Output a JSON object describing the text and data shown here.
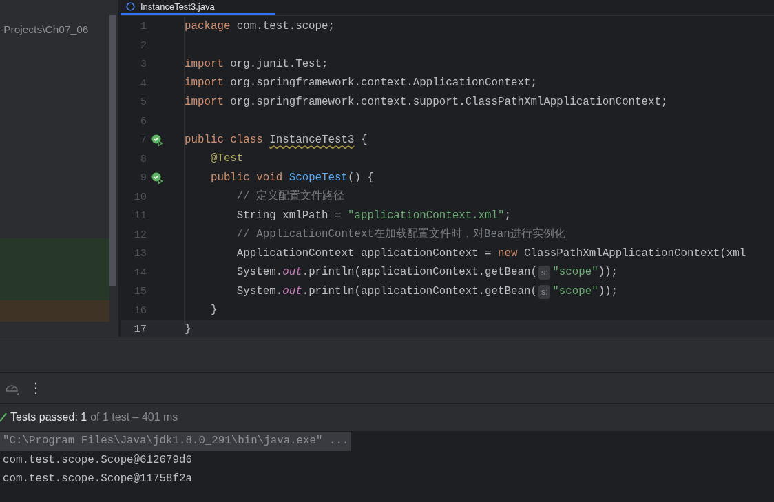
{
  "project_panel": {
    "path": "-Projects\\Ch07_06"
  },
  "editor_tabs": [
    {
      "label": "InstanceTest3.java",
      "selected": true
    }
  ],
  "code_lines": [
    {
      "number": "1",
      "run_icon": false,
      "current": false,
      "tokens": [
        {
          "kind": "keyword",
          "text": "package "
        },
        {
          "kind": "plain",
          "text": "com.test.scope;"
        }
      ]
    },
    {
      "number": "2",
      "run_icon": false,
      "current": false
    },
    {
      "number": "3",
      "run_icon": false,
      "current": false,
      "tokens": [
        {
          "kind": "keyword",
          "text": "import "
        },
        {
          "kind": "plain",
          "text": "org.junit.Test;"
        }
      ]
    },
    {
      "number": "4",
      "run_icon": false,
      "current": false,
      "tokens": [
        {
          "kind": "keyword",
          "text": "import "
        },
        {
          "kind": "plain",
          "text": "org.springframework.context.ApplicationContext;"
        }
      ]
    },
    {
      "number": "5",
      "run_icon": false,
      "current": false,
      "tokens": [
        {
          "kind": "keyword",
          "text": "import "
        },
        {
          "kind": "plain",
          "text": "org.springframework.context.support.ClassPathXmlApplicationContext;"
        }
      ]
    },
    {
      "number": "6",
      "run_icon": false,
      "current": false
    },
    {
      "number": "7",
      "run_icon": true,
      "current": false,
      "tokens": [
        {
          "kind": "keyword",
          "text": "public class "
        },
        {
          "kind": "warning",
          "text": "InstanceTest3"
        },
        {
          "kind": "plain",
          "text": " {"
        }
      ]
    },
    {
      "number": "8",
      "run_icon": false,
      "current": false,
      "tokens": [
        {
          "kind": "annotation",
          "text": "    @Test"
        }
      ]
    },
    {
      "number": "9",
      "run_icon": true,
      "current": false,
      "tokens": [
        {
          "kind": "keyword",
          "text": "    public void "
        },
        {
          "kind": "method",
          "text": "ScopeTest"
        },
        {
          "kind": "plain",
          "text": "() {"
        }
      ]
    },
    {
      "number": "10",
      "run_icon": false,
      "current": false,
      "tokens": [
        {
          "kind": "comment",
          "text": "        // 定义配置文件路径"
        }
      ]
    },
    {
      "number": "11",
      "run_icon": false,
      "current": false,
      "tokens": [
        {
          "kind": "plain",
          "text": "        String xmlPath = "
        },
        {
          "kind": "string",
          "text": "\"applicationContext.xml\""
        },
        {
          "kind": "plain",
          "text": ";"
        }
      ]
    },
    {
      "number": "12",
      "run_icon": false,
      "current": false,
      "tokens": [
        {
          "kind": "comment",
          "text": "        // ApplicationContext在加载配置文件时，对Bean进行实例化"
        }
      ]
    },
    {
      "number": "13",
      "run_icon": false,
      "current": false,
      "tokens": [
        {
          "kind": "plain",
          "text": "        ApplicationContext applicationContext = "
        },
        {
          "kind": "keyword",
          "text": "new "
        },
        {
          "kind": "plain",
          "text": "ClassPathXmlApplicationContext(xml"
        }
      ]
    },
    {
      "number": "14",
      "run_icon": false,
      "current": false,
      "tokens": [
        {
          "kind": "plain",
          "text": "        System."
        },
        {
          "kind": "static",
          "text": "out"
        },
        {
          "kind": "plain",
          "text": ".println(applicationContext.getBean("
        },
        {
          "kind": "hint",
          "text": "s:"
        },
        {
          "kind": "string",
          "text": "\"scope\""
        },
        {
          "kind": "plain",
          "text": "));"
        }
      ]
    },
    {
      "number": "15",
      "run_icon": false,
      "current": false,
      "tokens": [
        {
          "kind": "plain",
          "text": "        System."
        },
        {
          "kind": "static",
          "text": "out"
        },
        {
          "kind": "plain",
          "text": ".println(applicationContext.getBean("
        },
        {
          "kind": "hint",
          "text": "s:"
        },
        {
          "kind": "string",
          "text": "\"scope\""
        },
        {
          "kind": "plain",
          "text": "));"
        }
      ]
    },
    {
      "number": "16",
      "run_icon": false,
      "current": false,
      "tokens": [
        {
          "kind": "plain",
          "text": "    }"
        }
      ]
    },
    {
      "number": "17",
      "run_icon": false,
      "current": true,
      "tokens": [
        {
          "kind": "plain",
          "text": "}"
        }
      ]
    }
  ],
  "run_toolbar": {
    "menu_glyph": "⋮"
  },
  "test_status": {
    "passed": true,
    "summary": "Tests passed: 1",
    "detail": "of 1 test – 401 ms"
  },
  "console_lines": [
    {
      "text": "\"C:\\Program Files\\Java\\jdk1.8.0_291\\bin\\java.exe\" ...",
      "selected": true
    },
    {
      "text": "com.test.scope.Scope@612679d6",
      "selected": false
    },
    {
      "text": "com.test.scope.Scope@11758f2a",
      "selected": false
    }
  ]
}
